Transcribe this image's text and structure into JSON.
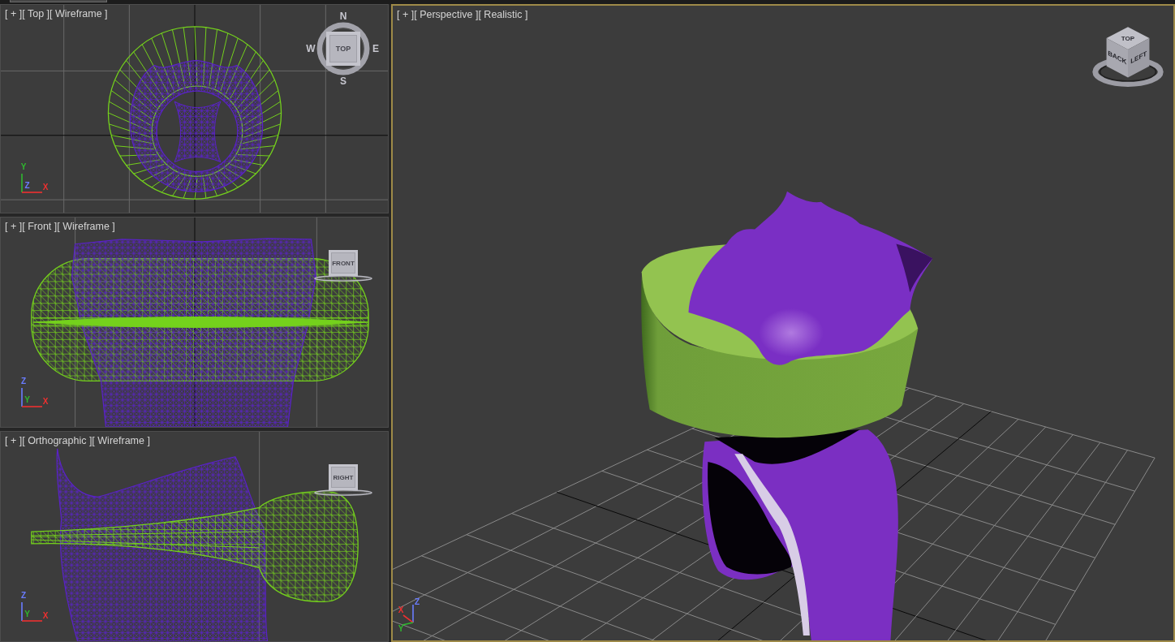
{
  "viewports": [
    {
      "kind": "top",
      "active": false,
      "menus": [
        "[ + ]",
        "[ Top ]",
        "[ Wireframe ]"
      ],
      "cube": {
        "kind": "compass",
        "faces": [
          "TOP"
        ],
        "compass": {
          "north": "N",
          "east": "E",
          "south": "S",
          "west": "W"
        }
      },
      "axes": [
        {
          "label": "Y",
          "color": "#2fb82f"
        },
        {
          "label": "Z",
          "color": "#6a7cff"
        },
        {
          "label": "X",
          "color": "#ee3030"
        }
      ]
    },
    {
      "kind": "front",
      "active": false,
      "menus": [
        "[ + ]",
        "[ Front ]",
        "[ Wireframe ]"
      ],
      "cube": {
        "kind": "ring",
        "faces": [
          "FRONT"
        ]
      },
      "axes": [
        {
          "label": "Z",
          "color": "#6a7cff"
        },
        {
          "label": "Y",
          "color": "#2fb82f"
        },
        {
          "label": "X",
          "color": "#ee3030"
        }
      ]
    },
    {
      "kind": "orthographic",
      "active": false,
      "menus": [
        "[ + ]",
        "[ Orthographic ]",
        "[ Wireframe ]"
      ],
      "cube": {
        "kind": "ring",
        "faces": [
          "RIGHT"
        ]
      },
      "axes": [
        {
          "label": "Z",
          "color": "#6a7cff"
        },
        {
          "label": "Y",
          "color": "#2fb82f"
        },
        {
          "label": "X",
          "color": "#ee3030"
        }
      ]
    },
    {
      "kind": "perspective",
      "active": true,
      "menus": [
        "[ + ]",
        "[ Perspective ]",
        "[ Realistic ]"
      ],
      "cube": {
        "kind": "iso",
        "faces": [
          "TOP",
          "BACK",
          "LEFT"
        ]
      },
      "axes": [
        {
          "label": "Z",
          "color": "#6a7cff"
        },
        {
          "label": "X",
          "color": "#ee3030"
        },
        {
          "label": "Y",
          "color": "#2fb82f"
        }
      ]
    }
  ]
}
